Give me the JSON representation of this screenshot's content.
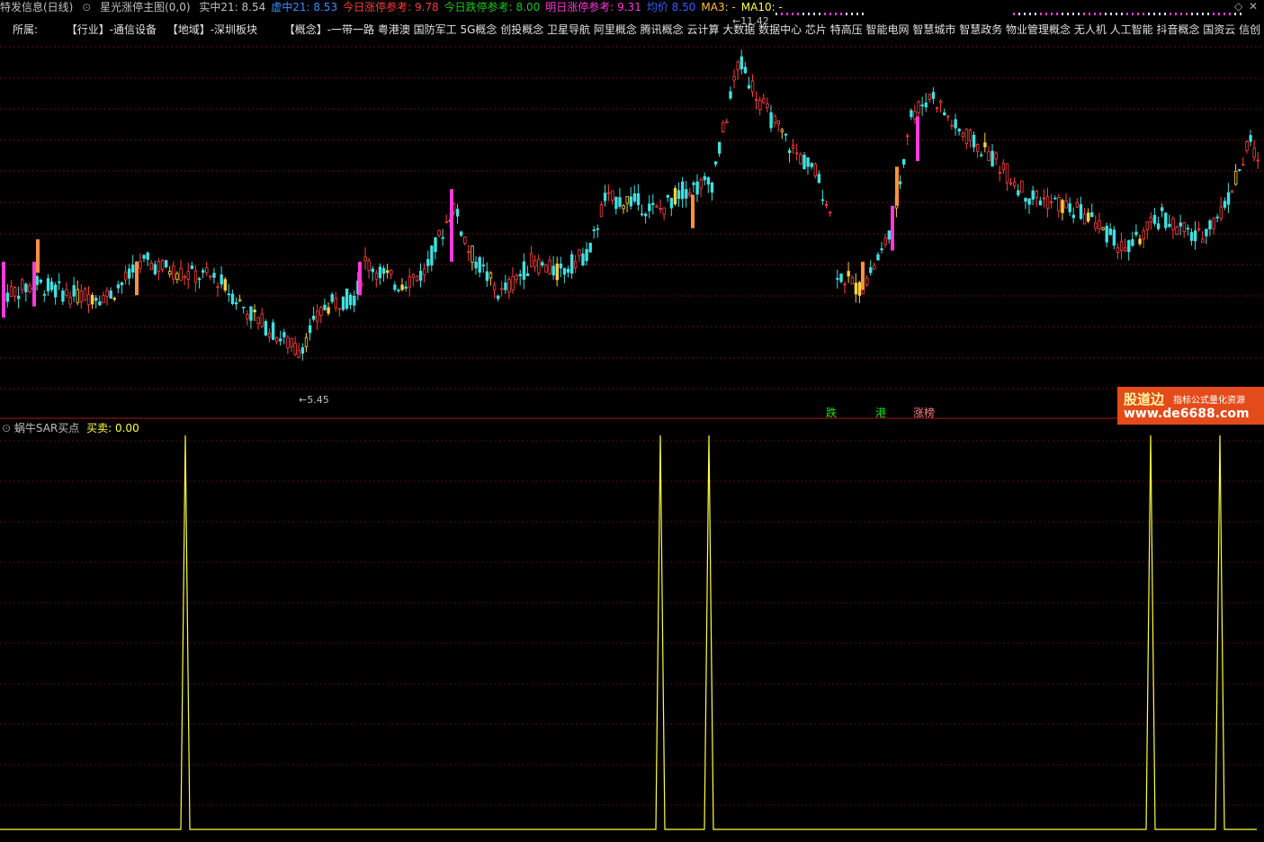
{
  "header": {
    "stock_name": "特发信息(日线)",
    "indicator_title": "星光涨停主图(0,0)",
    "items": [
      {
        "label": "实中21:",
        "value": "8.54",
        "color": "#c0c0c0"
      },
      {
        "label": "虚中21:",
        "value": "8.53",
        "color": "#3a8cff"
      },
      {
        "label": "今日涨停参考:",
        "value": "9.78",
        "color": "#ff3a3a"
      },
      {
        "label": "今日跌停参考:",
        "value": "8.00",
        "color": "#19c819"
      },
      {
        "label": "明日涨停参考:",
        "value": "9.31",
        "color": "#ff3ad8"
      },
      {
        "label": "均价",
        "value": "8.50",
        "color": "#3a5cff"
      },
      {
        "label": "MA3:",
        "value": "-",
        "color": "#ffc030"
      },
      {
        "label": "MA10:",
        "value": "-",
        "color": "#ffff40"
      }
    ],
    "corner_icon": "diamond-icon",
    "close_icon": "close-icon"
  },
  "concepts": {
    "prefix": "所属:",
    "industry": "【行业】-通信设备",
    "region": "【地域】-深圳板块",
    "concept": "【概念】-一带一路 粤港澳 国防军工 5G概念 创投概念 卫星导航 阿里概念 腾讯概念 云计算 大数据 数据中心 芯片 特高压 智能电网 智慧城市 智慧政务 物业管理概念 无人机 人工智能 抖音概念 国资云 信创 东?"
  },
  "annotations": {
    "high_label": "11.42",
    "low_label": "5.45",
    "tags": [
      "跌",
      "港",
      "涨榜"
    ]
  },
  "sub_panel": {
    "title": "蜗牛SAR买点",
    "value_label": "买卖:",
    "value": "0.00",
    "signal_positions": [
      206,
      734,
      788,
      1279,
      1356
    ]
  },
  "promo": {
    "title": "股道边",
    "subtitle": "指标公式量化资源",
    "url": "www.de6688.com"
  },
  "chart_data": {
    "type": "candlestick",
    "price_low": 5.45,
    "price_high": 11.42,
    "grid": true
  }
}
